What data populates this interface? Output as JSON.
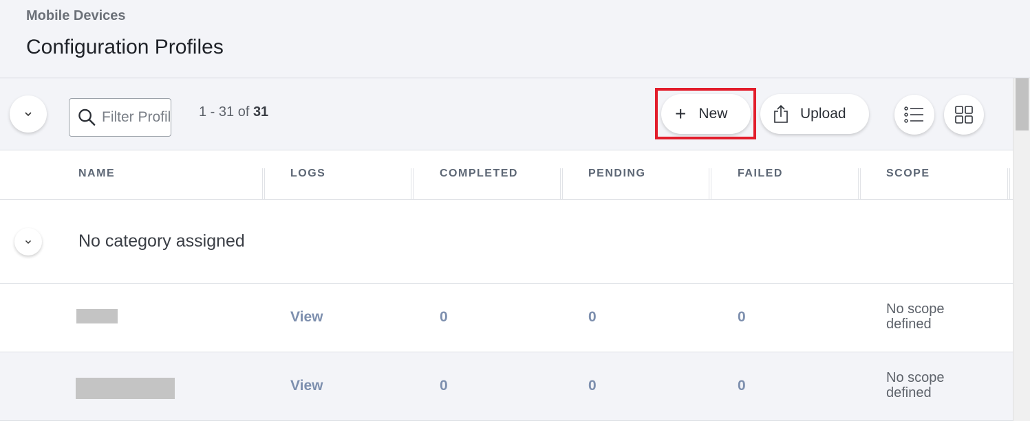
{
  "header": {
    "breadcrumb": "Mobile Devices",
    "title": "Configuration Profiles"
  },
  "toolbar": {
    "filter_placeholder": "Filter Profiles",
    "count_prefix": "1 - 31 of ",
    "count_total": "31",
    "new_label": "New",
    "upload_label": "Upload"
  },
  "table": {
    "columns": [
      "NAME",
      "LOGS",
      "COMPLETED",
      "PENDING",
      "FAILED",
      "SCOPE"
    ],
    "group": {
      "label": "No category assigned"
    },
    "rows": [
      {
        "logs": "View",
        "completed": "0",
        "pending": "0",
        "failed": "0",
        "scope_line1": "No scope",
        "scope_line2": "defined"
      },
      {
        "logs": "View",
        "completed": "0",
        "pending": "0",
        "failed": "0",
        "scope_line1": "No scope",
        "scope_line2": "defined"
      }
    ]
  },
  "colors": {
    "highlight": "#e21d2b",
    "link": "#7d8fae"
  }
}
